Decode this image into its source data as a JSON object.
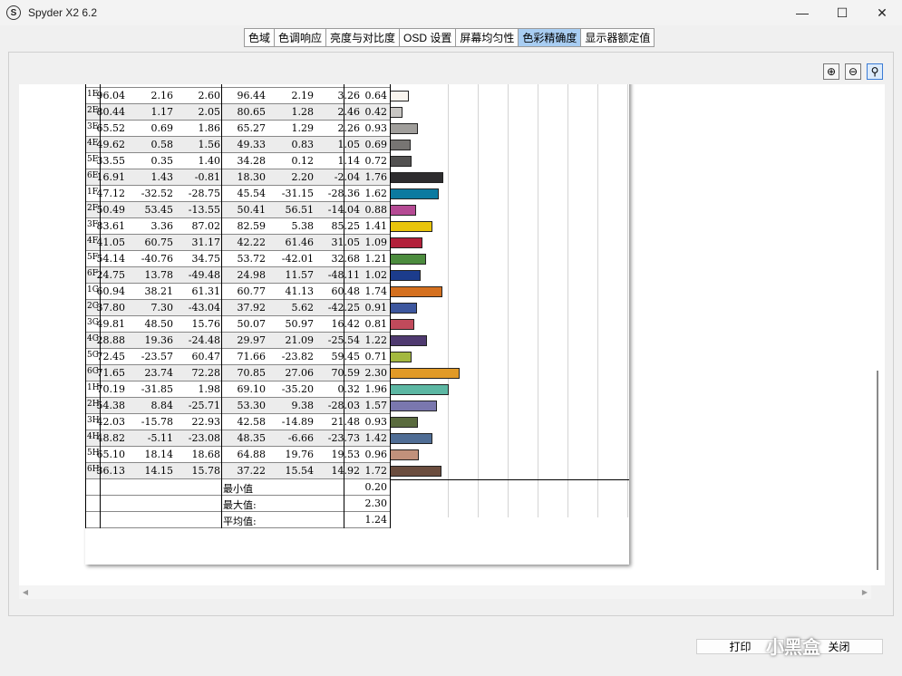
{
  "window": {
    "title": "Spyder X2 6.2",
    "app_icon": "S"
  },
  "tabs": [
    {
      "label": "色域",
      "active": false
    },
    {
      "label": "色调响应",
      "active": false
    },
    {
      "label": "亮度与对比度",
      "active": false
    },
    {
      "label": "OSD 设置",
      "active": false
    },
    {
      "label": "屏幕均匀性",
      "active": false
    },
    {
      "label": "色彩精确度",
      "active": true
    },
    {
      "label": "显示器额定值",
      "active": false
    }
  ],
  "color_accuracy": {
    "rows": [
      {
        "id": "1E",
        "v": [
          "96.04",
          "2.16",
          "2.60",
          "96.44",
          "2.19",
          "3.26",
          "0.64"
        ],
        "color": "#f9f5ef"
      },
      {
        "id": "2E",
        "v": [
          "80.44",
          "1.17",
          "2.05",
          "80.65",
          "1.28",
          "2.46",
          "0.42"
        ],
        "color": "#c8c6c3"
      },
      {
        "id": "3E",
        "v": [
          "65.52",
          "0.69",
          "1.86",
          "65.27",
          "1.29",
          "2.26",
          "0.93"
        ],
        "color": "#a09e9b"
      },
      {
        "id": "4E",
        "v": [
          "49.62",
          "0.58",
          "1.56",
          "49.33",
          "0.83",
          "1.05",
          "0.69"
        ],
        "color": "#777573"
      },
      {
        "id": "5E",
        "v": [
          "33.55",
          "0.35",
          "1.40",
          "34.28",
          "0.12",
          "1.14",
          "0.72"
        ],
        "color": "#525150"
      },
      {
        "id": "6E",
        "v": [
          "16.91",
          "1.43",
          "-0.81",
          "18.30",
          "2.20",
          "-2.04",
          "1.76"
        ],
        "color": "#2d2c2e"
      },
      {
        "id": "1F",
        "v": [
          "47.12",
          "-32.52",
          "-28.75",
          "45.54",
          "-31.15",
          "-28.36",
          "1.62"
        ],
        "color": "#0b7aa0"
      },
      {
        "id": "2F",
        "v": [
          "50.49",
          "53.45",
          "-13.55",
          "50.41",
          "56.51",
          "-14.04",
          "0.88"
        ],
        "color": "#b54a94"
      },
      {
        "id": "3F",
        "v": [
          "83.61",
          "3.36",
          "87.02",
          "82.59",
          "5.38",
          "85.25",
          "1.41"
        ],
        "color": "#e9c40c"
      },
      {
        "id": "4F",
        "v": [
          "41.05",
          "60.75",
          "31.17",
          "42.22",
          "61.46",
          "31.05",
          "1.09"
        ],
        "color": "#b2203a"
      },
      {
        "id": "5F",
        "v": [
          "54.14",
          "-40.76",
          "34.75",
          "53.72",
          "-42.01",
          "32.68",
          "1.21"
        ],
        "color": "#4c8c3e"
      },
      {
        "id": "6F",
        "v": [
          "24.75",
          "13.78",
          "-49.48",
          "24.98",
          "11.57",
          "-48.11",
          "1.02"
        ],
        "color": "#1c3c8c"
      },
      {
        "id": "1G",
        "v": [
          "60.94",
          "38.21",
          "61.31",
          "60.77",
          "41.13",
          "60.48",
          "1.74"
        ],
        "color": "#d4701f"
      },
      {
        "id": "2G",
        "v": [
          "37.80",
          "7.30",
          "-43.04",
          "37.92",
          "5.62",
          "-42.25",
          "0.91"
        ],
        "color": "#3d579e"
      },
      {
        "id": "3G",
        "v": [
          "49.81",
          "48.50",
          "15.76",
          "50.07",
          "50.97",
          "16.42",
          "0.81"
        ],
        "color": "#c14a5b"
      },
      {
        "id": "4G",
        "v": [
          "28.88",
          "19.36",
          "-24.48",
          "29.97",
          "21.09",
          "-25.54",
          "1.22"
        ],
        "color": "#4f3a70"
      },
      {
        "id": "5G",
        "v": [
          "72.45",
          "-23.57",
          "60.47",
          "71.66",
          "-23.82",
          "59.45",
          "0.71"
        ],
        "color": "#a3b83f"
      },
      {
        "id": "6G",
        "v": [
          "71.65",
          "23.74",
          "72.28",
          "70.85",
          "27.06",
          "70.59",
          "2.30"
        ],
        "color": "#e19a27"
      },
      {
        "id": "1H",
        "v": [
          "70.19",
          "-31.85",
          "1.98",
          "69.10",
          "-35.20",
          "0.32",
          "1.96"
        ],
        "color": "#5cb7a3"
      },
      {
        "id": "2H",
        "v": [
          "54.38",
          "8.84",
          "-25.71",
          "53.30",
          "9.38",
          "-28.03",
          "1.57"
        ],
        "color": "#7a77ae"
      },
      {
        "id": "3H",
        "v": [
          "42.03",
          "-15.78",
          "22.93",
          "42.58",
          "-14.89",
          "21.48",
          "0.93"
        ],
        "color": "#5a6b3e"
      },
      {
        "id": "4H",
        "v": [
          "48.82",
          "-5.11",
          "-23.08",
          "48.35",
          "-6.66",
          "-23.73",
          "1.42"
        ],
        "color": "#4f6d95"
      },
      {
        "id": "5H",
        "v": [
          "65.10",
          "18.14",
          "18.68",
          "64.88",
          "19.76",
          "19.53",
          "0.96"
        ],
        "color": "#c1917b"
      },
      {
        "id": "6H",
        "v": [
          "36.13",
          "14.15",
          "15.78",
          "37.22",
          "15.54",
          "14.92",
          "1.72"
        ],
        "color": "#6b4d3e"
      }
    ],
    "summary": [
      {
        "label": "最小值",
        "value": "0.20"
      },
      {
        "label": "最大值:",
        "value": "2.30"
      },
      {
        "label": "平均值:",
        "value": "1.24"
      }
    ],
    "bar_max": 3.0
  },
  "buttons": {
    "print": "打印",
    "close": "关闭"
  },
  "watermark": "小黑盒"
}
